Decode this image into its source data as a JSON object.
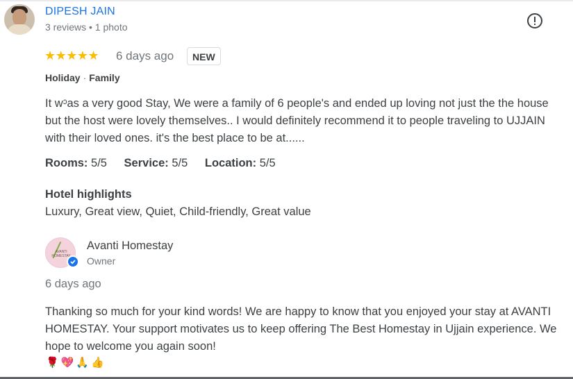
{
  "review": {
    "reviewer_name": "DIPESH JAIN",
    "reviewer_meta": "3 reviews • 1 photo",
    "stars": "★★★★★",
    "rating": 5,
    "date": "6 days ago",
    "badge": "NEW",
    "trip_type": "Holiday",
    "trip_group": "Family",
    "text": "It wᵓas a very good Stay, We were a family of 6 people's and ended up loving not just the the house but the host were lovely themselves.. I would definitely recommend it to people traveling to UJJAIN with their loved ones. it's the best place to be at......",
    "ratings": [
      {
        "label": "Rooms:",
        "value": "5/5"
      },
      {
        "label": "Service:",
        "value": "5/5"
      },
      {
        "label": "Location:",
        "value": "5/5"
      }
    ],
    "highlights_title": "Hotel highlights",
    "highlights": "Luxury, Great view, Quiet, Child-friendly, Great value"
  },
  "owner_reply": {
    "name": "Avanti Homestay",
    "role": "Owner",
    "logo_text": "AVANTI HOMESTAY",
    "date": "6 days ago",
    "text": "Thanking so much for your kind words! We are happy to know that you enjoyed your stay at AVANTI HOMESTAY. Your support motivates us to keep offering The Best Homestay in Ujjain experience. We hope to welcome you again soon!",
    "emojis": "🌹💖🙏👍"
  },
  "icons": {
    "report": "report-flag-icon",
    "verified": "verified-check-icon"
  },
  "colors": {
    "link_blue": "#1a73e8",
    "star_yellow": "#fbbc04",
    "secondary_text": "#70757a"
  }
}
